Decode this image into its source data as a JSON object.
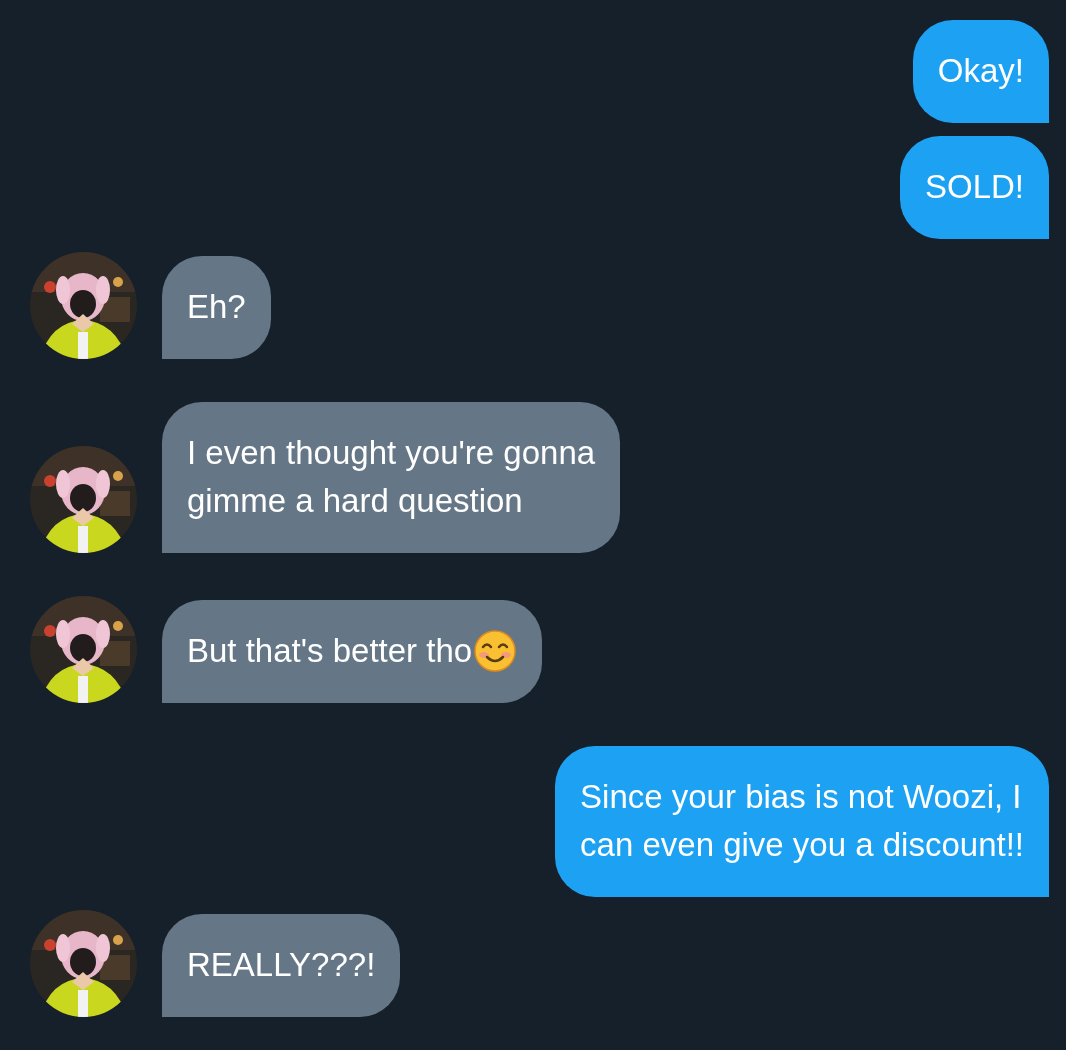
{
  "messages": [
    {
      "kind": "sent",
      "text": "Okay!"
    },
    {
      "kind": "sent",
      "text": "SOLD!"
    },
    {
      "kind": "received",
      "text": "Eh?"
    },
    {
      "kind": "received",
      "text": "I even thought you're gonna\ngimme a hard question"
    },
    {
      "kind": "received_emoji",
      "text": "But that's better tho"
    },
    {
      "kind": "sent",
      "text": "Since your bias is not Woozi, I\ncan even give you a discount!!"
    },
    {
      "kind": "received",
      "text": "REALLY???!"
    }
  ]
}
